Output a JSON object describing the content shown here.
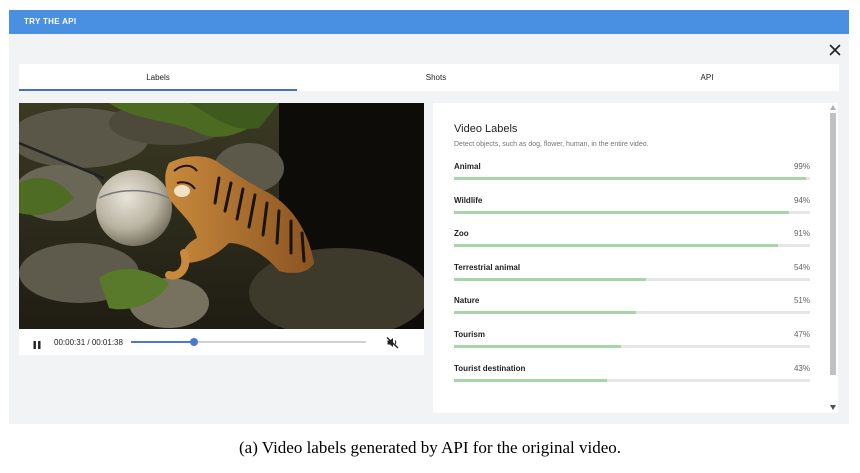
{
  "header": {
    "title": "TRY THE API"
  },
  "tabs": [
    {
      "label": "Labels",
      "active": true
    },
    {
      "label": "Shots",
      "active": false
    },
    {
      "label": "API",
      "active": false
    }
  ],
  "player": {
    "current_time": "00:00:31",
    "separator": " / ",
    "total_time": "00:01:38",
    "progress": 0.27,
    "muted": true
  },
  "labels_panel": {
    "title": "Video Labels",
    "subtitle": "Detect objects, such as dog, flower, human, in the entire video.",
    "items": [
      {
        "name": "Animal",
        "percent": "99%",
        "value": 0.99
      },
      {
        "name": "Wildlife",
        "percent": "94%",
        "value": 0.94
      },
      {
        "name": "Zoo",
        "percent": "91%",
        "value": 0.91
      },
      {
        "name": "Terrestrial animal",
        "percent": "54%",
        "value": 0.54
      },
      {
        "name": "Nature",
        "percent": "51%",
        "value": 0.51
      },
      {
        "name": "Tourism",
        "percent": "47%",
        "value": 0.47
      },
      {
        "name": "Tourist destination",
        "percent": "43%",
        "value": 0.43
      }
    ]
  },
  "caption": "(a) Video labels generated by API for the original video.",
  "colors": {
    "header_bg": "#4a90e2",
    "accent": "#4a78d0",
    "bar_fill": "#a8d5a8",
    "panel_bg": "#f1f3f4"
  },
  "icons": {
    "close": "close-icon",
    "pause": "pause-icon",
    "mute": "volume-off-icon"
  }
}
